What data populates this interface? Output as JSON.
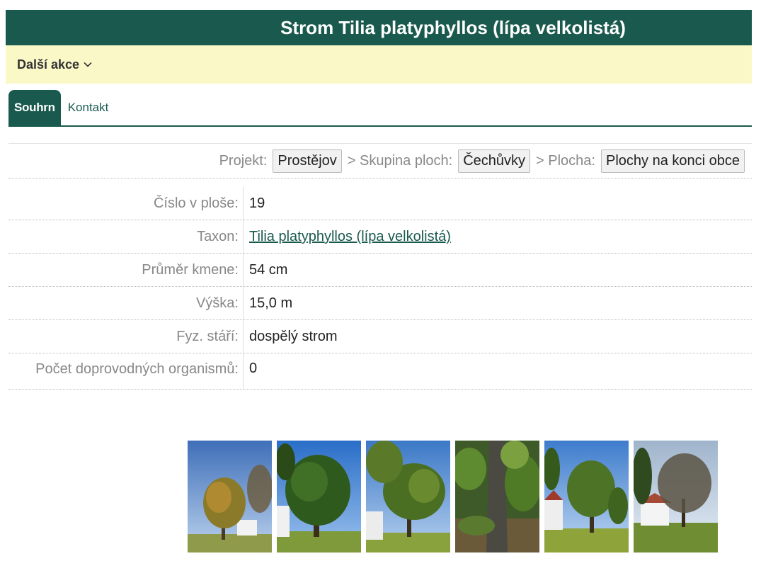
{
  "header": {
    "title": "Strom Tilia platyphyllos (lípa velkolistá)"
  },
  "actions": {
    "label": "Další akce"
  },
  "tabs": [
    {
      "label": "Souhrn",
      "active": true
    },
    {
      "label": "Kontakt",
      "active": false
    }
  ],
  "breadcrumb": {
    "project_label": "Projekt:",
    "project_value": "Prostějov",
    "sep1": "> Skupina ploch:",
    "group_value": "Čechůvky",
    "sep2": "> Plocha:",
    "area_value": "Plochy na konci obce"
  },
  "properties": [
    {
      "label": "Číslo v ploše:",
      "value": "19"
    },
    {
      "label": "Taxon:",
      "value": "Tilia platyphyllos (lípa velkolistá)"
    },
    {
      "label": "Průměr kmene:",
      "value": "54 cm"
    },
    {
      "label": "Výška:",
      "value": "15,0 m"
    },
    {
      "label": "Fyz. stáří:",
      "value": "dospělý strom"
    },
    {
      "label": "Počet doprovodných organismů:",
      "value": "0"
    }
  ],
  "colors": {
    "brand": "#1a5a4e",
    "action_bar": "#fbf8c8"
  }
}
